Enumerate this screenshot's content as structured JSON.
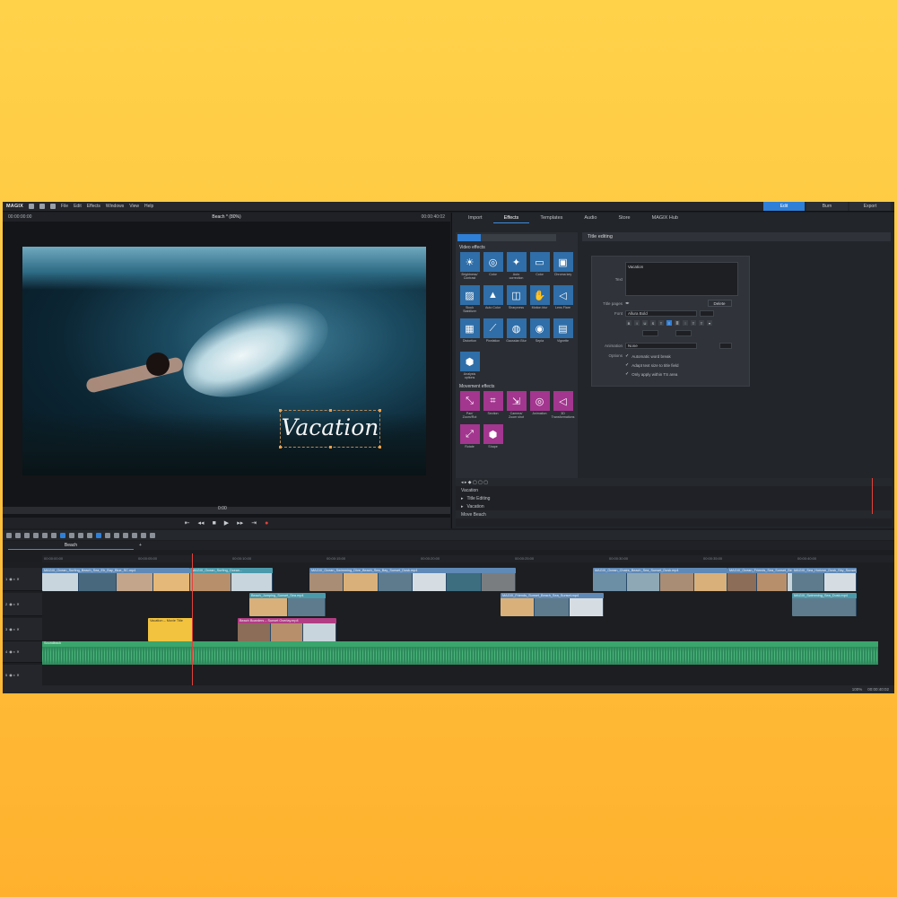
{
  "menubar": {
    "logo": "MAGIX",
    "items": [
      "File",
      "Edit",
      "Effects",
      "Windows",
      "View",
      "Help"
    ],
    "modes": [
      "Edit",
      "Burn",
      "Export"
    ],
    "active_mode": "Edit"
  },
  "preview": {
    "left_timecode": "00:00:00:00",
    "title": "Beach * (80%)",
    "right_timecode": "00:00:40:02",
    "overlay_text": "Vacation",
    "scrub_time": "0:00"
  },
  "right_panel": {
    "tabs": [
      "Import",
      "Effects",
      "Templates",
      "Audio",
      "Store",
      "MAGIX Hub"
    ],
    "active_tab": "Effects",
    "section_title": "Title editing",
    "video_effects_label": "Video effects",
    "video_effects": [
      {
        "label": "Brightness/ Contrast",
        "icon": "☀"
      },
      {
        "label": "Color",
        "icon": "◎"
      },
      {
        "label": "Auto correction",
        "icon": "✦"
      },
      {
        "label": "Color",
        "icon": "▭"
      },
      {
        "label": "Chroma key",
        "icon": "▣"
      },
      {
        "label": "Stock Stabilizer",
        "icon": "▨"
      },
      {
        "label": "Auto Color",
        "icon": "▲"
      },
      {
        "label": "Sharpness",
        "icon": "◫"
      },
      {
        "label": "Motion blur",
        "icon": "✋"
      },
      {
        "label": "Lens Flare",
        "icon": "◁"
      },
      {
        "label": "Distortion",
        "icon": "▦"
      },
      {
        "label": "Pixelation",
        "icon": "⟋"
      },
      {
        "label": "Gaussian Blur",
        "icon": "◍"
      },
      {
        "label": "Sepia",
        "icon": "◉"
      },
      {
        "label": "Vignette",
        "icon": "▤"
      },
      {
        "label": "Analysis options",
        "icon": "⬢"
      }
    ],
    "movement_label": "Movement effects",
    "movement_effects": [
      {
        "label": "Pan/ Zoom/Rot",
        "icon": "⤡"
      },
      {
        "label": "Section",
        "icon": "⌗"
      },
      {
        "label": "Camera/ Zoom shot",
        "icon": "⇲"
      },
      {
        "label": "Animation",
        "icon": "◎"
      },
      {
        "label": "3D Transformations",
        "icon": "◁"
      },
      {
        "label": "Rotate",
        "icon": "⤢"
      },
      {
        "label": "Shape",
        "icon": "⬢"
      }
    ],
    "title_editing": {
      "text_label": "Text",
      "text_value": "Vacation",
      "title_pages_label": "Title pages",
      "delete_label": "Delete",
      "font_label": "Font",
      "font_value": "Allura Bold",
      "formats": [
        "B",
        "I",
        "U",
        "S",
        "T",
        "≡",
        "≣",
        "⫶",
        "T",
        "T",
        "▾"
      ],
      "animation_label": "Animation",
      "animation_value": "None",
      "options_label": "Options",
      "options": [
        "Automatic word break",
        "Adapt text size to title field",
        "Only apply within TS area"
      ]
    },
    "mini_timeline": {
      "name": "Vacation",
      "rows": [
        "Title Editing",
        "Vacation"
      ],
      "footer": "Move Beach"
    }
  },
  "timeline": {
    "project_tab": "Beach",
    "ruler_time": "00:00:02:00",
    "ruler_marks": [
      "00:00:00:00",
      "00:00:05:00",
      "00:00:10:00",
      "00:00:15:00",
      "00:00:20:00",
      "00:00:25:00",
      "00:00:30:00",
      "00:00:35:00",
      "00:00:40:00"
    ],
    "tracks": [
      "1",
      "2",
      "3",
      "4",
      "5"
    ],
    "video_clips_track1": [
      "MAGIX_Ocean_Surfing_Beach_Sea_Eb_Bay_Blue_SC.mp4",
      "MAGIX_Ocean_Surfing_Ocean...",
      "MAGIX_Ocean_Swimming_Dive_Beach_Sea_Bay_Sunset_Dusk.mp4",
      "MAGIX_Ocean_Chairs_Beach_Sea_Sunset_Dusk.mp4",
      "MAGIX_Ocean_Friends_Sea_Sunset_Beach_Dusk.mp4",
      "MAGIX_Sea_Horizon_Dusk_Sky_Sunset_Sea_Sun_Dusk.mp4"
    ],
    "video_clips_track2": [
      "Beach_Jumping_Sunset_Sea.mp4",
      "MAGIX_Friends_Sunset_Beach_Sea_Sunset.mp4",
      "MAGIX_Swimming_Sea_Dusk.mp4"
    ],
    "title_clip": "Vacation – Movie Title",
    "overlay_clip": "Beach Boarders – Sunset Overlay.mp4",
    "audio_clip": "Soundtrack"
  },
  "statusbar": {
    "zoom": "100%",
    "time": "00:00:40:02"
  },
  "colors": {
    "background": "#ffc33d",
    "accent": "#2f7fd6",
    "video_clip": "#5f89b6",
    "audio_clip": "#2e8b5c",
    "title_clip": "#f3c33d",
    "overlay_clip": "#b23d84",
    "playhead": "#e0433b"
  }
}
